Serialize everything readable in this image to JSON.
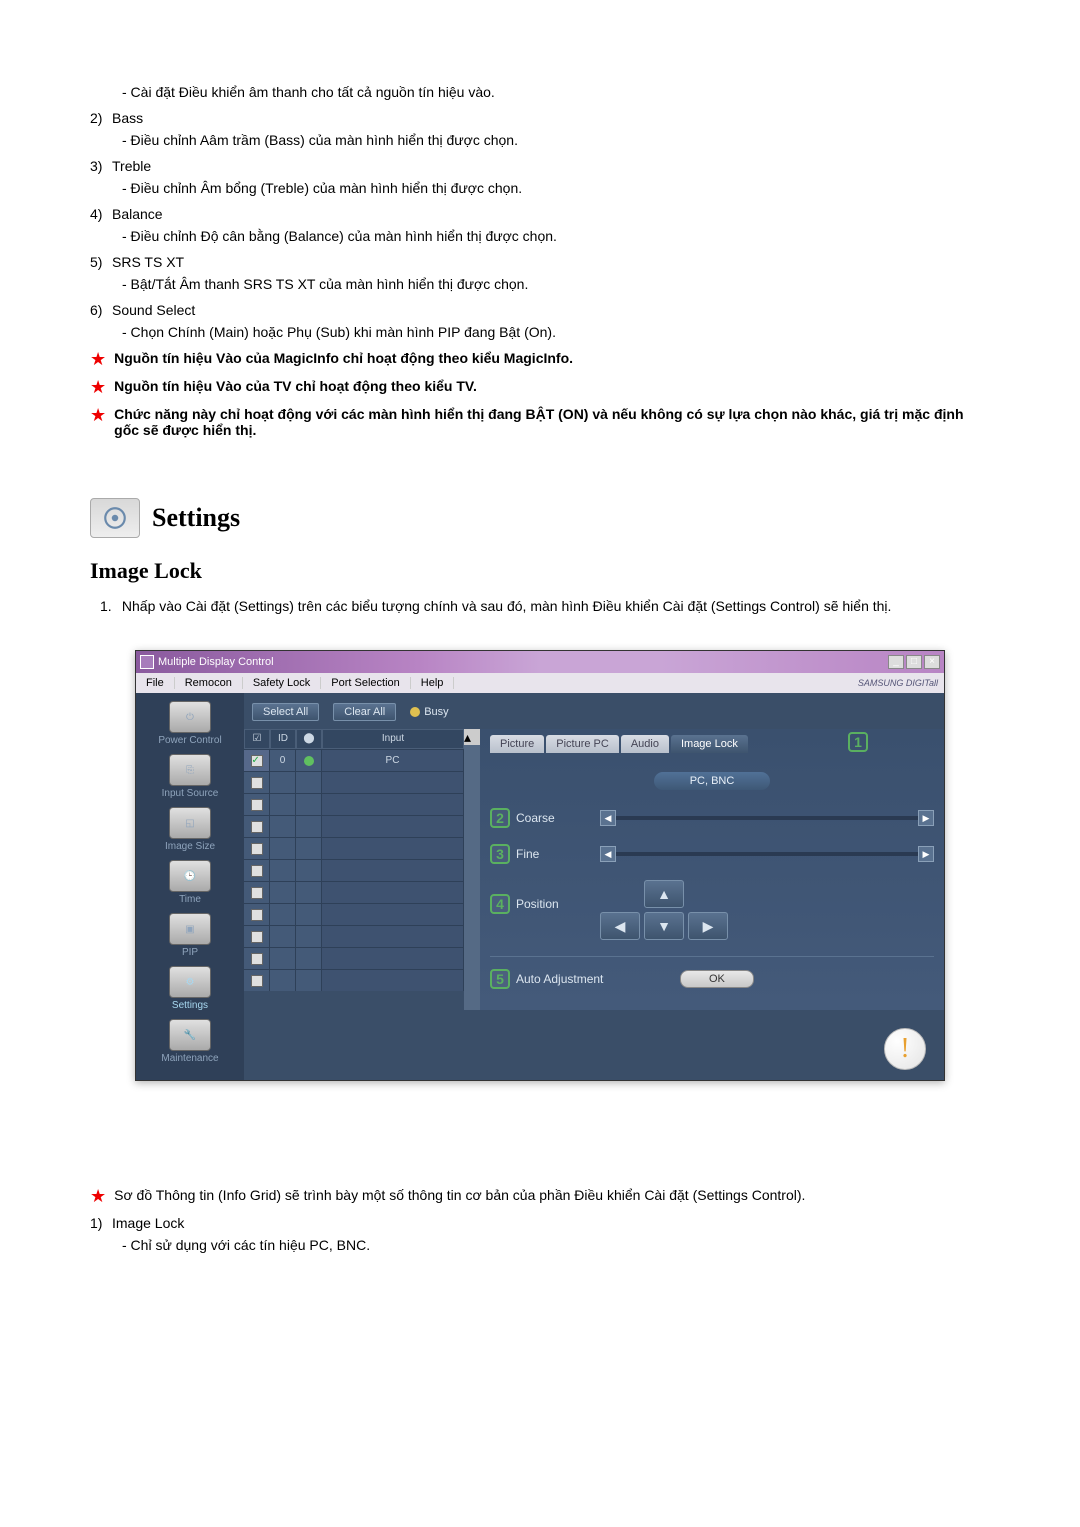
{
  "top_list": [
    {
      "num": "",
      "title": "",
      "desc": "- Cài đặt Điều khiển âm thanh cho tất cả nguồn tín hiệu vào."
    },
    {
      "num": "2)",
      "title": "Bass",
      "desc": "- Điều chỉnh Aâm trầm (Bass) của màn hình hiển thị được chọn."
    },
    {
      "num": "3)",
      "title": "Treble",
      "desc": "- Điều chỉnh Âm bổng (Treble) của màn hình hiển thị được chọn."
    },
    {
      "num": "4)",
      "title": "Balance",
      "desc": "- Điều chỉnh Độ cân bằng (Balance) của màn hình hiển thị được chọn."
    },
    {
      "num": "5)",
      "title": "SRS TS XT",
      "desc": "- Bật/Tắt Âm thanh SRS TS XT của màn hình hiển thị được chọn."
    },
    {
      "num": "6)",
      "title": "Sound Select",
      "desc": "- Chọn Chính (Main) hoặc Phụ (Sub) khi màn hình PIP đang Bật (On)."
    }
  ],
  "stars": [
    "Nguồn tín hiệu Vào của MagicInfo chỉ hoạt động theo kiểu MagicInfo.",
    "Nguồn tín hiệu Vào của TV chỉ hoạt động theo kiểu TV.",
    "Chức năng này chỉ hoạt động với các màn hình hiển thị đang BẬT (ON) và nếu không có sự lựa chọn nào khác, giá trị mặc định gốc sẽ được hiển thị."
  ],
  "section_title": "Settings",
  "sub_title": "Image Lock",
  "instr": {
    "num": "1.",
    "text": "Nhấp vào Cài đặt (Settings) trên các biểu tượng chính và sau đó, màn hình Điều khiển Cài đặt (Settings Control) sẽ hiển thị."
  },
  "window": {
    "title": "Multiple Display Control",
    "menus": [
      "File",
      "Remocon",
      "Safety Lock",
      "Port Selection",
      "Help"
    ],
    "brand": "SAMSUNG DIGITall",
    "toolbar": {
      "select_all": "Select All",
      "clear_all": "Clear All",
      "busy": "Busy"
    },
    "grid_headers": {
      "id": "ID",
      "input": "Input"
    },
    "grid_row": {
      "id": "0",
      "input": "PC"
    },
    "sidebar": [
      "Power Control",
      "Input Source",
      "Image Size",
      "Time",
      "PIP",
      "Settings",
      "Maintenance"
    ],
    "tabs": [
      "Picture",
      "Picture PC",
      "Audio",
      "Image Lock"
    ],
    "pill": "PC, BNC",
    "labels": {
      "coarse": "Coarse",
      "fine": "Fine",
      "position": "Position",
      "auto": "Auto Adjustment"
    },
    "callouts": {
      "c1": "1",
      "c2": "2",
      "c3": "3",
      "c4": "4",
      "c5": "5"
    },
    "ok": "OK"
  },
  "after_stars": "Sơ đồ Thông tin (Info Grid) sẽ trình bày một số thông tin cơ bản của phần Điều khiển Cài đặt (Settings Control).",
  "after_list": [
    {
      "num": "1)",
      "title": "Image Lock",
      "desc": "- Chỉ sử dụng với các tín hiệu PC, BNC."
    }
  ]
}
